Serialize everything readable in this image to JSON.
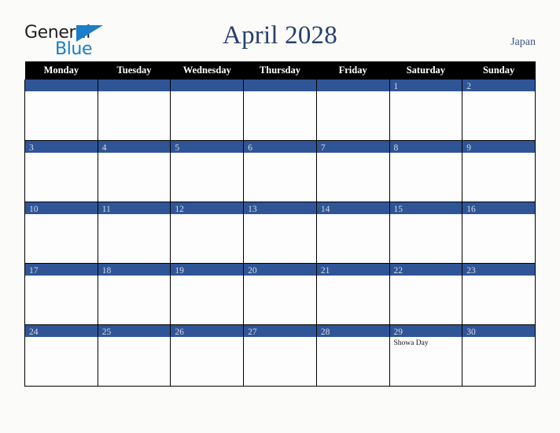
{
  "brand": {
    "name_part_1": "General",
    "name_part_2": "Blue",
    "triangle_color": "#1a7ec8"
  },
  "header": {
    "title": "April 2028",
    "region": "Japan",
    "title_color": "#27406e"
  },
  "calendar": {
    "weekday_headers": [
      "Monday",
      "Tuesday",
      "Wednesday",
      "Thursday",
      "Friday",
      "Saturday",
      "Sunday"
    ],
    "band_color": "#2f5597",
    "header_bg_color": "#000000",
    "cell_bg_color": "#fdfdfd",
    "weeks": [
      [
        {
          "day": "",
          "events": []
        },
        {
          "day": "",
          "events": []
        },
        {
          "day": "",
          "events": []
        },
        {
          "day": "",
          "events": []
        },
        {
          "day": "",
          "events": []
        },
        {
          "day": "1",
          "events": []
        },
        {
          "day": "2",
          "events": []
        }
      ],
      [
        {
          "day": "3",
          "events": []
        },
        {
          "day": "4",
          "events": []
        },
        {
          "day": "5",
          "events": []
        },
        {
          "day": "6",
          "events": []
        },
        {
          "day": "7",
          "events": []
        },
        {
          "day": "8",
          "events": []
        },
        {
          "day": "9",
          "events": []
        }
      ],
      [
        {
          "day": "10",
          "events": []
        },
        {
          "day": "11",
          "events": []
        },
        {
          "day": "12",
          "events": []
        },
        {
          "day": "13",
          "events": []
        },
        {
          "day": "14",
          "events": []
        },
        {
          "day": "15",
          "events": []
        },
        {
          "day": "16",
          "events": []
        }
      ],
      [
        {
          "day": "17",
          "events": []
        },
        {
          "day": "18",
          "events": []
        },
        {
          "day": "19",
          "events": []
        },
        {
          "day": "20",
          "events": []
        },
        {
          "day": "21",
          "events": []
        },
        {
          "day": "22",
          "events": []
        },
        {
          "day": "23",
          "events": []
        }
      ],
      [
        {
          "day": "24",
          "events": []
        },
        {
          "day": "25",
          "events": []
        },
        {
          "day": "26",
          "events": []
        },
        {
          "day": "27",
          "events": []
        },
        {
          "day": "28",
          "events": []
        },
        {
          "day": "29",
          "events": [
            "Showa Day"
          ]
        },
        {
          "day": "30",
          "events": []
        }
      ]
    ]
  }
}
